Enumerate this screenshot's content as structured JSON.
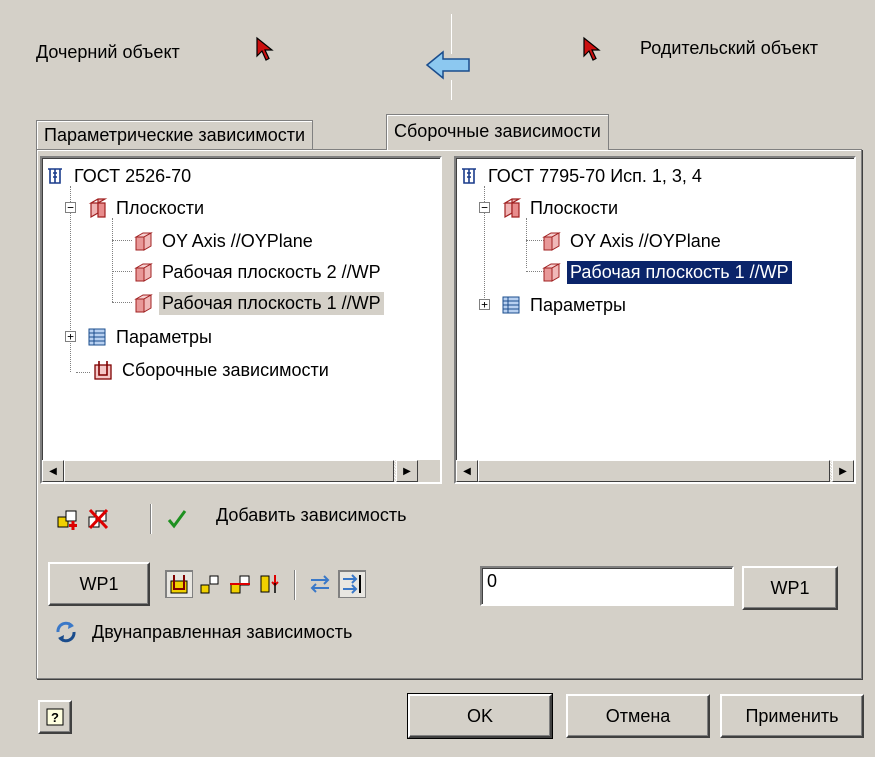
{
  "header": {
    "child_label": "Дочерний объект",
    "parent_label": "Родительский объект",
    "child_pick_icon": "cursor-pick-icon",
    "parent_pick_icon": "cursor-pick-icon",
    "direction_icon": "arrow-left-icon"
  },
  "tabs": [
    {
      "label": "Параметрические зависимости",
      "active": false
    },
    {
      "label": "Сборочные зависимости",
      "active": true
    }
  ],
  "left_tree": {
    "root": "ГОСТ 2526-70",
    "planes": "Плоскости",
    "plane_items": [
      "OY Axis //OYPlane",
      "Рабочая плоскость 2 //WP",
      "Рабочая плоскость 1 //WP"
    ],
    "parameters": "Параметры",
    "constraints": "Сборочные зависимости",
    "selected_index": 2
  },
  "right_tree": {
    "root": "ГОСТ 7795-70 Исп. 1, 3, 4",
    "planes": "Плоскости",
    "plane_items": [
      "OY Axis //OYPlane",
      "Рабочая плоскость 1 //WP"
    ],
    "parameters": "Параметры",
    "selected_index": 1
  },
  "actions": {
    "add_constraint_label": "Добавить зависимость"
  },
  "constraint_row": {
    "left_button": "WP1",
    "value": "0",
    "right_button": "WP1"
  },
  "bidirectional_label": "Двунаправленная зависимость",
  "footer": {
    "ok": "OK",
    "cancel": "Отмена",
    "apply": "Применить"
  },
  "colors": {
    "window_bg": "#d4d0c8",
    "selection": "#0a246a",
    "accent_red": "#cc0000",
    "accent_yellow": "#f0c000",
    "accent_blue": "#3a78c8"
  }
}
